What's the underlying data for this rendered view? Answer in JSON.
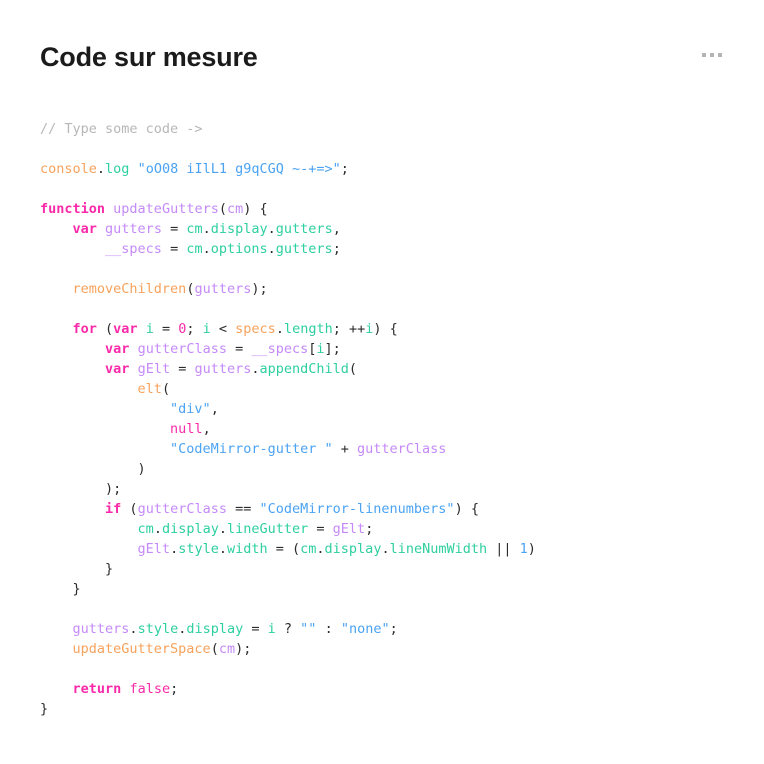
{
  "header": {
    "title": "Code sur mesure",
    "overflow_menu": {
      "icon": "ellipsis-horizontal-icon",
      "label": "•••",
      "color": "#b4b4b4"
    }
  },
  "theme": {
    "background": "#ffffff",
    "title_color": "#1b1b1b",
    "comment": "#b7b7b7",
    "keyword": "#f92aa9",
    "function": "#f7a25c",
    "method": "#2ecfa0",
    "variable": "#c58af8",
    "string": "#4ba3f2",
    "punctuation": "#2b2b2b"
  },
  "editor": {
    "language": "javascript",
    "font_size_px": 13.5,
    "line_height_px": 20,
    "indent_spaces": 4,
    "lines": [
      {
        "index": 1,
        "text": "// Type some code ->",
        "tokens": [
          {
            "v": "// Type some code ->",
            "c": "t-comment"
          }
        ]
      },
      {
        "index": 2,
        "text": "",
        "tokens": []
      },
      {
        "index": 3,
        "text": "console.log \"oO08 iIlL1 g9qCGQ ~-+=>\";",
        "tokens": [
          {
            "v": "console",
            "c": "t-func"
          },
          {
            "v": ".",
            "c": "t-punct"
          },
          {
            "v": "log",
            "c": "t-method"
          },
          {
            "v": " ",
            "c": "t-punct"
          },
          {
            "v": "\"oO08 iIlL1 g9qCGQ ~-+=>\"",
            "c": "t-string"
          },
          {
            "v": ";",
            "c": "t-punct"
          }
        ]
      },
      {
        "index": 4,
        "text": "",
        "tokens": []
      },
      {
        "index": 5,
        "text": "function updateGutters(cm) {",
        "tokens": [
          {
            "v": "function",
            "c": "t-keyword"
          },
          {
            "v": " ",
            "c": "t-punct"
          },
          {
            "v": "updateGutters",
            "c": "t-var"
          },
          {
            "v": "(",
            "c": "t-punct"
          },
          {
            "v": "cm",
            "c": "t-param"
          },
          {
            "v": ") {",
            "c": "t-punct"
          }
        ]
      },
      {
        "index": 6,
        "text": "    var gutters = cm.display.gutters,",
        "tokens": [
          {
            "v": "    ",
            "c": "t-punct"
          },
          {
            "v": "var",
            "c": "t-keyword"
          },
          {
            "v": " ",
            "c": "t-punct"
          },
          {
            "v": "gutters",
            "c": "t-var"
          },
          {
            "v": " = ",
            "c": "t-punct"
          },
          {
            "v": "cm",
            "c": "t-this"
          },
          {
            "v": ".",
            "c": "t-punct"
          },
          {
            "v": "display",
            "c": "t-prop"
          },
          {
            "v": ".",
            "c": "t-punct"
          },
          {
            "v": "gutters",
            "c": "t-prop"
          },
          {
            "v": ",",
            "c": "t-punct"
          }
        ]
      },
      {
        "index": 7,
        "text": "        __specs = cm.options.gutters;",
        "tokens": [
          {
            "v": "        ",
            "c": "t-punct"
          },
          {
            "v": "__specs",
            "c": "t-var"
          },
          {
            "v": " = ",
            "c": "t-punct"
          },
          {
            "v": "cm",
            "c": "t-this"
          },
          {
            "v": ".",
            "c": "t-punct"
          },
          {
            "v": "options",
            "c": "t-prop"
          },
          {
            "v": ".",
            "c": "t-punct"
          },
          {
            "v": "gutters",
            "c": "t-prop"
          },
          {
            "v": ";",
            "c": "t-punct"
          }
        ]
      },
      {
        "index": 8,
        "text": "",
        "tokens": []
      },
      {
        "index": 9,
        "text": "    removeChildren(gutters);",
        "tokens": [
          {
            "v": "    ",
            "c": "t-punct"
          },
          {
            "v": "removeChildren",
            "c": "t-func"
          },
          {
            "v": "(",
            "c": "t-punct"
          },
          {
            "v": "gutters",
            "c": "t-var"
          },
          {
            "v": ");",
            "c": "t-punct"
          }
        ]
      },
      {
        "index": 10,
        "text": "",
        "tokens": []
      },
      {
        "index": 11,
        "text": "    for (var i = 0; i < specs.length; ++i) {",
        "tokens": [
          {
            "v": "    ",
            "c": "t-punct"
          },
          {
            "v": "for",
            "c": "t-keyword"
          },
          {
            "v": " (",
            "c": "t-punct"
          },
          {
            "v": "var",
            "c": "t-keyword"
          },
          {
            "v": " ",
            "c": "t-punct"
          },
          {
            "v": "i",
            "c": "t-this"
          },
          {
            "v": " = ",
            "c": "t-punct"
          },
          {
            "v": "0",
            "c": "t-number"
          },
          {
            "v": "; ",
            "c": "t-punct"
          },
          {
            "v": "i",
            "c": "t-this"
          },
          {
            "v": " < ",
            "c": "t-punct"
          },
          {
            "v": "specs",
            "c": "t-func"
          },
          {
            "v": ".",
            "c": "t-punct"
          },
          {
            "v": "length",
            "c": "t-prop"
          },
          {
            "v": "; ++",
            "c": "t-punct"
          },
          {
            "v": "i",
            "c": "t-this"
          },
          {
            "v": ") {",
            "c": "t-punct"
          }
        ]
      },
      {
        "index": 12,
        "text": "        var gutterClass = __specs[i];",
        "tokens": [
          {
            "v": "        ",
            "c": "t-punct"
          },
          {
            "v": "var",
            "c": "t-keyword"
          },
          {
            "v": " ",
            "c": "t-punct"
          },
          {
            "v": "gutterClass",
            "c": "t-var"
          },
          {
            "v": " = ",
            "c": "t-punct"
          },
          {
            "v": "__specs",
            "c": "t-var"
          },
          {
            "v": "[",
            "c": "t-punct"
          },
          {
            "v": "i",
            "c": "t-this"
          },
          {
            "v": "];",
            "c": "t-punct"
          }
        ]
      },
      {
        "index": 13,
        "text": "        var gElt = gutters.appendChild(",
        "tokens": [
          {
            "v": "        ",
            "c": "t-punct"
          },
          {
            "v": "var",
            "c": "t-keyword"
          },
          {
            "v": " ",
            "c": "t-punct"
          },
          {
            "v": "gElt",
            "c": "t-var"
          },
          {
            "v": " = ",
            "c": "t-punct"
          },
          {
            "v": "gutters",
            "c": "t-var"
          },
          {
            "v": ".",
            "c": "t-punct"
          },
          {
            "v": "appendChild",
            "c": "t-method"
          },
          {
            "v": "(",
            "c": "t-punct"
          }
        ]
      },
      {
        "index": 14,
        "text": "            elt(",
        "tokens": [
          {
            "v": "            ",
            "c": "t-punct"
          },
          {
            "v": "elt",
            "c": "t-func"
          },
          {
            "v": "(",
            "c": "t-punct"
          }
        ]
      },
      {
        "index": 15,
        "text": "                \"div\",",
        "tokens": [
          {
            "v": "                ",
            "c": "t-punct"
          },
          {
            "v": "\"div\"",
            "c": "t-string"
          },
          {
            "v": ",",
            "c": "t-punct"
          }
        ]
      },
      {
        "index": 16,
        "text": "                null,",
        "tokens": [
          {
            "v": "                ",
            "c": "t-punct"
          },
          {
            "v": "null",
            "c": "t-literal"
          },
          {
            "v": ",",
            "c": "t-punct"
          }
        ]
      },
      {
        "index": 17,
        "text": "                \"CodeMirror-gutter \" + gutterClass",
        "tokens": [
          {
            "v": "                ",
            "c": "t-punct"
          },
          {
            "v": "\"CodeMirror-gutter \"",
            "c": "t-string"
          },
          {
            "v": " + ",
            "c": "t-punct"
          },
          {
            "v": "gutterClass",
            "c": "t-var"
          }
        ]
      },
      {
        "index": 18,
        "text": "            )",
        "tokens": [
          {
            "v": "            )",
            "c": "t-punct"
          }
        ]
      },
      {
        "index": 19,
        "text": "        );",
        "tokens": [
          {
            "v": "        );",
            "c": "t-punct"
          }
        ]
      },
      {
        "index": 20,
        "text": "        if (gutterClass == \"CodeMirror-linenumbers\") {",
        "tokens": [
          {
            "v": "        ",
            "c": "t-punct"
          },
          {
            "v": "if",
            "c": "t-keyword"
          },
          {
            "v": " (",
            "c": "t-punct"
          },
          {
            "v": "gutterClass",
            "c": "t-var"
          },
          {
            "v": " == ",
            "c": "t-punct"
          },
          {
            "v": "\"CodeMirror-linenumbers\"",
            "c": "t-string"
          },
          {
            "v": ") {",
            "c": "t-punct"
          }
        ]
      },
      {
        "index": 21,
        "text": "            cm.display.lineGutter = gElt;",
        "tokens": [
          {
            "v": "            ",
            "c": "t-punct"
          },
          {
            "v": "cm",
            "c": "t-this"
          },
          {
            "v": ".",
            "c": "t-punct"
          },
          {
            "v": "display",
            "c": "t-prop"
          },
          {
            "v": ".",
            "c": "t-punct"
          },
          {
            "v": "lineGutter",
            "c": "t-prop"
          },
          {
            "v": " = ",
            "c": "t-punct"
          },
          {
            "v": "gElt",
            "c": "t-var"
          },
          {
            "v": ";",
            "c": "t-punct"
          }
        ]
      },
      {
        "index": 22,
        "text": "            gElt.style.width = (cm.display.lineNumWidth || 1)",
        "tokens": [
          {
            "v": "            ",
            "c": "t-punct"
          },
          {
            "v": "gElt",
            "c": "t-var"
          },
          {
            "v": ".",
            "c": "t-punct"
          },
          {
            "v": "style",
            "c": "t-prop"
          },
          {
            "v": ".",
            "c": "t-punct"
          },
          {
            "v": "width",
            "c": "t-prop"
          },
          {
            "v": " = (",
            "c": "t-punct"
          },
          {
            "v": "cm",
            "c": "t-this"
          },
          {
            "v": ".",
            "c": "t-punct"
          },
          {
            "v": "display",
            "c": "t-prop"
          },
          {
            "v": ".",
            "c": "t-punct"
          },
          {
            "v": "lineNumWidth",
            "c": "t-prop"
          },
          {
            "v": " || ",
            "c": "t-punct"
          },
          {
            "v": "1",
            "c": "t-num-blue"
          },
          {
            "v": ")",
            "c": "t-punct"
          }
        ]
      },
      {
        "index": 23,
        "text": "        }",
        "tokens": [
          {
            "v": "        }",
            "c": "t-punct"
          }
        ]
      },
      {
        "index": 24,
        "text": "    }",
        "tokens": [
          {
            "v": "    }",
            "c": "t-punct"
          }
        ]
      },
      {
        "index": 25,
        "text": "",
        "tokens": []
      },
      {
        "index": 26,
        "text": "    gutters.style.display = i ? \"\" : \"none\";",
        "tokens": [
          {
            "v": "    ",
            "c": "t-punct"
          },
          {
            "v": "gutters",
            "c": "t-var"
          },
          {
            "v": ".",
            "c": "t-punct"
          },
          {
            "v": "style",
            "c": "t-prop"
          },
          {
            "v": ".",
            "c": "t-punct"
          },
          {
            "v": "display",
            "c": "t-prop"
          },
          {
            "v": " = ",
            "c": "t-punct"
          },
          {
            "v": "i",
            "c": "t-this"
          },
          {
            "v": " ? ",
            "c": "t-punct"
          },
          {
            "v": "\"\"",
            "c": "t-string"
          },
          {
            "v": " : ",
            "c": "t-punct"
          },
          {
            "v": "\"none\"",
            "c": "t-string"
          },
          {
            "v": ";",
            "c": "t-punct"
          }
        ]
      },
      {
        "index": 27,
        "text": "    updateGutterSpace(cm);",
        "tokens": [
          {
            "v": "    ",
            "c": "t-punct"
          },
          {
            "v": "updateGutterSpace",
            "c": "t-func"
          },
          {
            "v": "(",
            "c": "t-punct"
          },
          {
            "v": "cm",
            "c": "t-param"
          },
          {
            "v": ");",
            "c": "t-punct"
          }
        ]
      },
      {
        "index": 28,
        "text": "",
        "tokens": []
      },
      {
        "index": 29,
        "text": "    return false;",
        "tokens": [
          {
            "v": "    ",
            "c": "t-punct"
          },
          {
            "v": "return",
            "c": "t-keyword"
          },
          {
            "v": " ",
            "c": "t-punct"
          },
          {
            "v": "false",
            "c": "t-literal"
          },
          {
            "v": ";",
            "c": "t-punct"
          }
        ]
      },
      {
        "index": 30,
        "text": "}",
        "tokens": [
          {
            "v": "}",
            "c": "t-punct"
          }
        ]
      }
    ]
  }
}
